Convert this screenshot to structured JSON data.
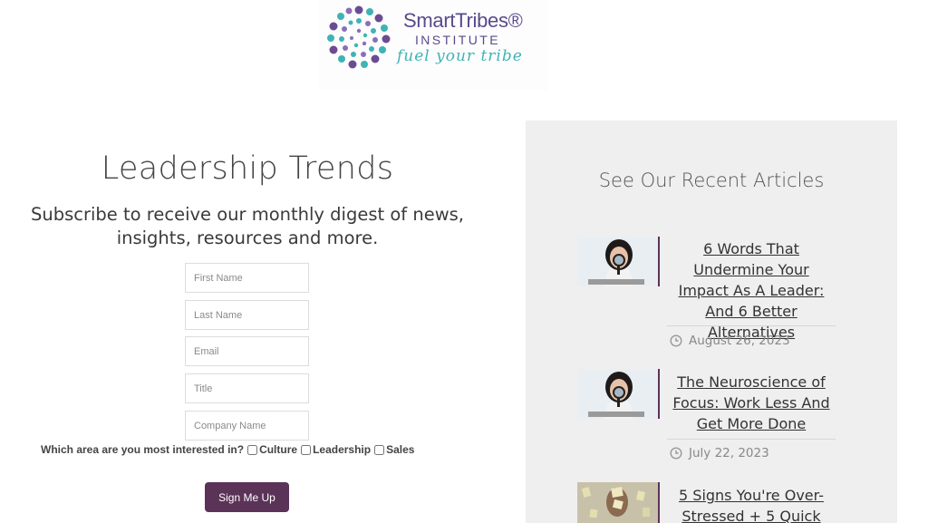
{
  "logo": {
    "name": "SmartTribes®",
    "institute": "INSTITUTE",
    "tagline": "fuel your tribe"
  },
  "signup": {
    "title": "Leadership Trends",
    "subtitle": "Subscribe to receive our monthly digest of news, insights, resources and more.",
    "fields": {
      "first_name": "First Name",
      "last_name": "Last Name",
      "email": "Email",
      "title": "Title",
      "company": "Company Name"
    },
    "interest_question": "Which area are you most interested in?",
    "interest_options": [
      "Culture",
      "Leadership",
      "Sales"
    ],
    "button_label": "Sign Me Up"
  },
  "articles": {
    "heading": "See Our Recent Articles",
    "items": [
      {
        "title": "6 Words That Undermine Your Impact As A Leader: And 6 Better Alternatives",
        "date": "August 26, 2023",
        "icon": "clock-icon"
      },
      {
        "title": "The Neuroscience of Focus: Work Less And Get More Done",
        "date": "July 22, 2023",
        "icon": "clock-icon"
      },
      {
        "title": "5 Signs You're Over-Stressed + 5 Quick",
        "date": "",
        "icon": "clock-icon"
      }
    ]
  },
  "colors": {
    "brand_purple": "#5b3358",
    "logo_purple": "#5a4a8c",
    "logo_teal": "#3fb3b5",
    "panel_bg": "#efefef"
  }
}
